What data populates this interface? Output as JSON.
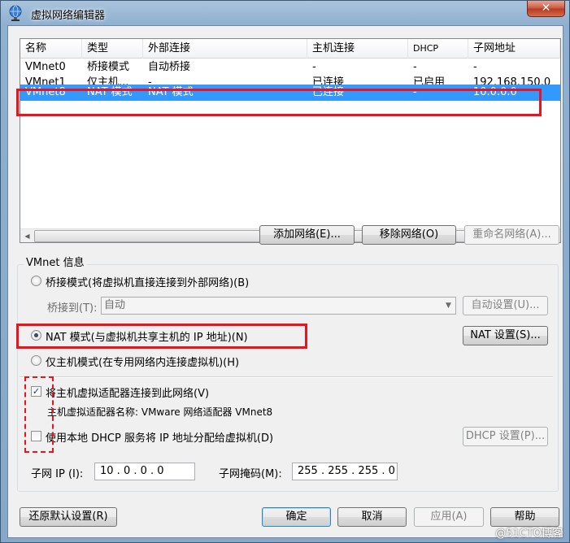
{
  "window": {
    "title": "虚拟网络编辑器",
    "close": "✕"
  },
  "network_list": {
    "columns": [
      "名称",
      "类型",
      "外部连接",
      "主机连接",
      "DHCP",
      "子网地址"
    ],
    "rows": [
      {
        "name": "VMnet0",
        "type": "桥接模式",
        "external": "自动桥接",
        "host": "-",
        "dhcp": "-",
        "subnet": "-",
        "selected": false
      },
      {
        "name": "VMnet1",
        "type": "仅主机...",
        "external": "-",
        "host": "已连接",
        "dhcp": "已启用",
        "subnet": "192.168.150.0",
        "selected": false
      },
      {
        "name": "VMnet8",
        "type": "NAT 模式",
        "external": "NAT 模式",
        "host": "已连接",
        "dhcp": "-",
        "subnet": "10.0.0.0",
        "selected": true
      }
    ],
    "scroll_left": "◀",
    "scroll_right": "▶",
    "scroll_grip": "|||"
  },
  "list_buttons": {
    "add": "添加网络(E)...",
    "remove": "移除网络(O)",
    "rename": "重命名网络(A)..."
  },
  "vmnet_info": {
    "group_label": "VMnet 信息",
    "bridged_label": "桥接模式(将虚拟机直接连接到外部网络)(B)",
    "bridge_to_label": "桥接到(T):",
    "bridge_to_value": "自动",
    "auto_settings": "自动设置(U)...",
    "nat_label": "NAT 模式(与虚拟机共享主机的 IP 地址)(N)",
    "nat_settings": "NAT 设置(S)...",
    "hostonly_label": "仅主机模式(在专用网络内连接虚拟机)(H)",
    "connect_adapter_label": "将主机虚拟适配器连接到此网络(V)",
    "connect_adapter_checked": true,
    "adapter_name_label": "主机虚拟适配器名称: VMware 网络适配器 VMnet8",
    "dhcp_label": "使用本地 DHCP 服务将 IP 地址分配给虚拟机(D)",
    "dhcp_checked": false,
    "dhcp_settings": "DHCP 设置(P)...",
    "subnet_ip_label": "子网 IP (I):",
    "subnet_ip_value": "10 . 0 . 0 . 0",
    "subnet_mask_label": "子网掩码(M):",
    "subnet_mask_value": "255 . 255 . 255 . 0",
    "checkmark": "✓"
  },
  "footer_buttons": {
    "restore": "还原默认设置(R)",
    "ok": "确定",
    "cancel": "取消",
    "apply": "应用(A)",
    "help": "帮助"
  },
  "watermark": "@51CTO博客",
  "colors": {
    "selection": "#3399ff",
    "annotation": "#e8141e"
  }
}
